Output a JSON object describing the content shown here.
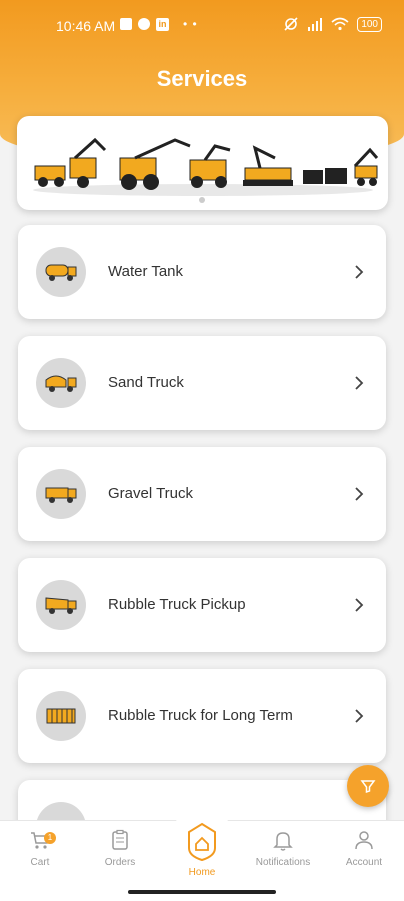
{
  "status_bar": {
    "time": "10:46 AM",
    "battery": "100"
  },
  "page": {
    "title": "Services"
  },
  "services": [
    {
      "label": "Water Tank",
      "icon": "water-tank-truck-icon"
    },
    {
      "label": "Sand Truck",
      "icon": "sand-truck-icon"
    },
    {
      "label": "Gravel Truck",
      "icon": "gravel-truck-icon"
    },
    {
      "label": "Rubble Truck Pickup",
      "icon": "rubble-truck-icon"
    },
    {
      "label": "Rubble Truck for Long Term",
      "icon": "container-icon"
    }
  ],
  "nav": {
    "cart": "Cart",
    "cart_badge": "1",
    "orders": "Orders",
    "home": "Home",
    "notifications": "Notifications",
    "account": "Account"
  },
  "colors": {
    "accent": "#f29a1f",
    "inactive": "#9a9a9a"
  }
}
